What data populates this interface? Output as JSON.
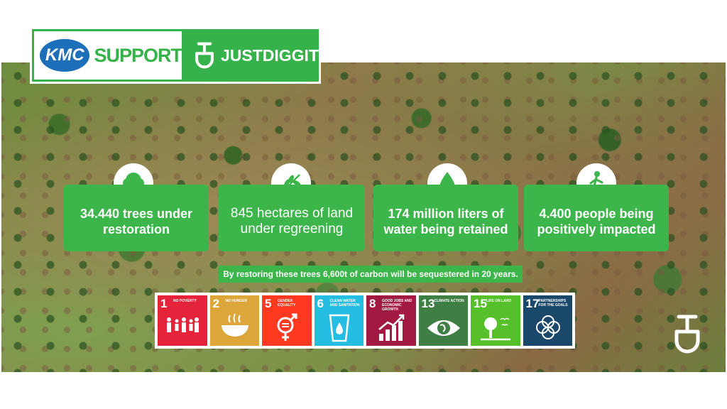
{
  "header": {
    "kmc_logo_text": "KMC",
    "support_text": "SUPPORT",
    "partner_text": "JUSTDIGGIT"
  },
  "stats": [
    {
      "icon": "tree-icon",
      "text": "34.440 trees under restoration"
    },
    {
      "icon": "leaf-branch-icon",
      "text": "845 hectares of land under regreening"
    },
    {
      "icon": "water-drop-icon",
      "text": "174 million liters of water being retained"
    },
    {
      "icon": "walking-person-icon",
      "text": "4.400 people being positively impacted"
    }
  ],
  "carbon_note": "By  restoring these trees 6,600t of carbon will be sequestered in 20 years.",
  "sdg_goals": [
    {
      "number": "1",
      "label": "NO POVERTY",
      "color": "#e5243b",
      "icon": "family-icon"
    },
    {
      "number": "2",
      "label": "NO HUNGER",
      "color": "#dda63a",
      "icon": "bowl-icon"
    },
    {
      "number": "5",
      "label": "GENDER EQUALITY",
      "color": "#ff3a21",
      "icon": "gender-icon"
    },
    {
      "number": "6",
      "label": "CLEAN WATER AND SANITATION",
      "color": "#26bde2",
      "icon": "water-glass-icon"
    },
    {
      "number": "8",
      "label": "GOOD JOBS AND ECONOMIC GROWTH",
      "color": "#a21942",
      "icon": "growth-chart-icon"
    },
    {
      "number": "13",
      "label": "CLIMATE ACTION",
      "color": "#3f7e44",
      "icon": "eye-globe-icon"
    },
    {
      "number": "15",
      "label": "LIFE ON LAND",
      "color": "#56c02b",
      "icon": "tree-birds-icon"
    },
    {
      "number": "17",
      "label": "PARTNERSHIPS FOR THE GOALS",
      "color": "#19486a",
      "icon": "flower-rings-icon"
    }
  ],
  "colors": {
    "brand_green": "#3cb54a",
    "kmc_blue": "#1c6fb8"
  }
}
